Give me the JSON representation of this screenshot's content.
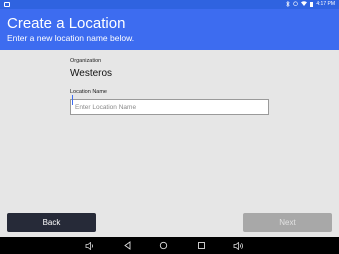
{
  "status_bar": {
    "time": "4:17 PM",
    "icons": [
      "bluetooth-icon",
      "alarm-icon",
      "wifi-icon",
      "battery-icon"
    ]
  },
  "header": {
    "title": "Create a Location",
    "subtitle": "Enter a new location name below."
  },
  "form": {
    "organization_label": "Organization",
    "organization_value": "Westeros",
    "location_label": "Location Name",
    "location_value": "",
    "location_placeholder": "Enter Location Name"
  },
  "buttons": {
    "back_label": "Back",
    "next_label": "Next",
    "next_enabled": false
  },
  "nav_bar": {
    "icons": [
      "volume-down-icon",
      "back-icon",
      "home-icon",
      "recents-icon",
      "volume-up-icon"
    ]
  },
  "colors": {
    "header": "#3d6cf0",
    "status_bar": "#2f63e0",
    "back_button": "#262a38",
    "next_button_disabled": "#a8a8a8",
    "background": "#e6e6e6"
  }
}
